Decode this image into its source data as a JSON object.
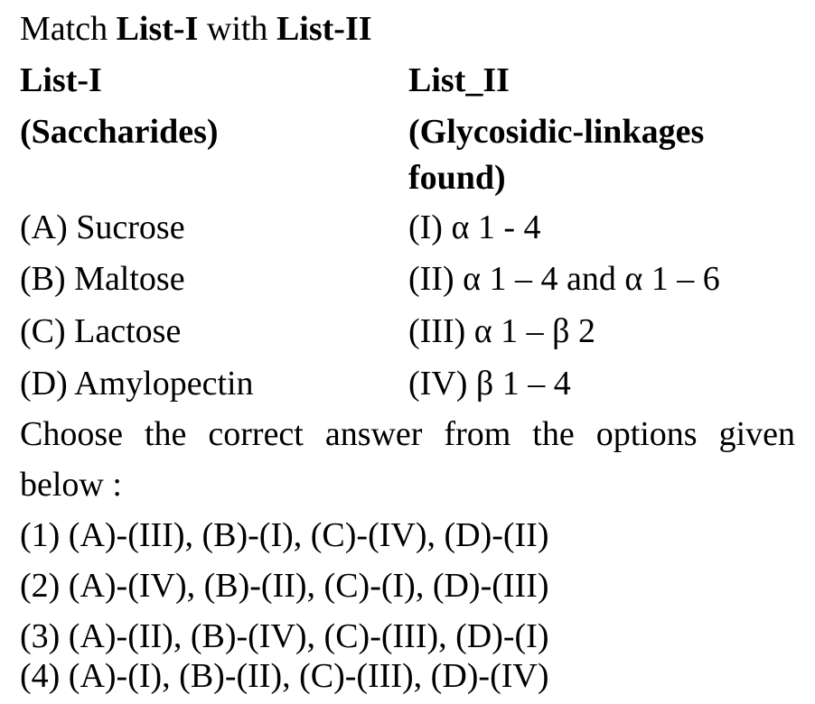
{
  "intro": {
    "match": "Match",
    "list1": "List-I",
    "with": "with",
    "list2": "List-II"
  },
  "headers": {
    "list1_title": "List-I",
    "list1_subtitle": "(Saccharides)",
    "list2_title": "List_II",
    "list2_subtitle_line1": "(Glycosidic-linkages",
    "list2_subtitle_line2": "found)"
  },
  "rows": [
    {
      "left": "(A) Sucrose",
      "right": "(I) α 1 - 4"
    },
    {
      "left": "(B) Maltose",
      "right": "(II) α 1 – 4 and α 1 – 6"
    },
    {
      "left": "(C) Lactose",
      "right": "(III) α 1 – β 2"
    },
    {
      "left": "(D) Amylopectin",
      "right": "(IV) β 1 – 4"
    }
  ],
  "instruction": {
    "line1": "Choose the correct answer from the options given",
    "line2": "below :"
  },
  "options": [
    "(1) (A)-(III), (B)-(I), (C)-(IV), (D)-(II)",
    "(2) (A)-(IV), (B)-(II), (C)-(I), (D)-(III)",
    "(3) (A)-(II), (B)-(IV), (C)-(III), (D)-(I)",
    "(4) (A)-(I), (B)-(II), (C)-(III), (D)-(IV)"
  ]
}
